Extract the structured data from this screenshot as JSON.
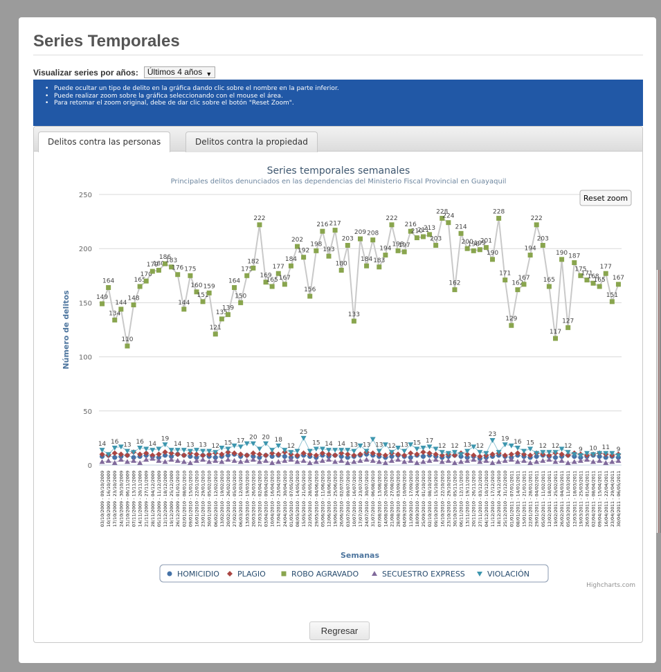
{
  "page": {
    "title": "Series Temporales"
  },
  "filter": {
    "label": "Visualizar series por años:",
    "value": "Últimos 4 años"
  },
  "info": [
    "Puede ocultar un tipo de delito en la gráfica dando clic sobre el nombre en la parte inferior.",
    "Puede realizar zoom sobre la gráfica seleccionando con el mouse el área.",
    "Para retomar el zoom original, debe de dar clic sobre el botón \"Reset Zoom\"."
  ],
  "tabs": [
    {
      "label": "Delitos contra las personas",
      "active": true
    },
    {
      "label": "Delitos contra la propiedad",
      "active": false
    }
  ],
  "chart_controls": {
    "reset_zoom": "Reset zoom",
    "credits": "Highcharts.com"
  },
  "buttons": {
    "back": "Regresar"
  },
  "chart_data": {
    "type": "line",
    "title": "Series temporales semanales",
    "subtitle": "Principales delitos denunciados en las dependencias del Ministerio Fiscal Provincial en Guayaquil",
    "xlabel": "Semanas",
    "ylabel": "Número de delitos",
    "ylim": [
      0,
      250
    ],
    "yticks": [
      0,
      50,
      100,
      150,
      200,
      250
    ],
    "grid": true,
    "legend_position": "bottom",
    "x": [
      "03/10/2009 - 09/10/2009",
      "10/10/2009 - 16/10/2009",
      "17/10/2009 - 23/10/2009",
      "24/10/2009 - 30/10/2009",
      "31/10/2009 - 06/11/2009",
      "07/11/2009 - 13/11/2009",
      "14/11/2009 - 20/11/2009",
      "21/11/2009 - 27/11/2009",
      "28/11/2009 - 04/12/2009",
      "05/12/2009 - 11/12/2009",
      "12/12/2009 - 18/12/2009",
      "19/12/2009 - 25/12/2009",
      "26/12/2009 - 01/01/2010",
      "02/01/2010 - 08/01/2010",
      "09/01/2010 - 15/01/2010",
      "16/01/2010 - 22/01/2010",
      "23/01/2010 - 29/01/2010",
      "30/01/2010 - 05/02/2010",
      "06/02/2010 - 12/02/2010",
      "13/02/2010 - 19/02/2010",
      "20/02/2010 - 26/02/2010",
      "27/02/2010 - 05/03/2010",
      "06/03/2010 - 12/03/2010",
      "13/03/2010 - 19/03/2010",
      "20/03/2010 - 26/03/2010",
      "27/03/2010 - 02/04/2010",
      "03/04/2010 - 09/04/2010",
      "10/04/2010 - 16/04/2010",
      "17/04/2010 - 23/04/2010",
      "24/04/2010 - 30/04/2010",
      "01/05/2010 - 07/05/2010",
      "08/05/2010 - 14/05/2010",
      "15/05/2010 - 21/05/2010",
      "22/05/2010 - 28/05/2010",
      "29/05/2010 - 04/06/2010",
      "05/06/2010 - 11/06/2010",
      "12/06/2010 - 18/06/2010",
      "19/06/2010 - 25/06/2010",
      "26/06/2010 - 02/07/2010",
      "03/07/2010 - 09/07/2010",
      "10/07/2010 - 16/07/2010",
      "17/07/2010 - 23/07/2010",
      "24/07/2010 - 30/07/2010",
      "31/07/2010 - 06/08/2010",
      "07/08/2010 - 13/08/2010",
      "14/08/2010 - 20/08/2010",
      "21/08/2010 - 27/08/2010",
      "28/08/2010 - 03/09/2010",
      "04/09/2010 - 10/09/2010",
      "11/09/2010 - 17/09/2010",
      "18/09/2010 - 24/09/2010",
      "25/09/2010 - 01/10/2010",
      "02/10/2010 - 08/10/2010",
      "09/10/2010 - 15/10/2010",
      "16/10/2010 - 22/10/2010",
      "23/10/2010 - 29/10/2010",
      "30/10/2010 - 05/11/2010",
      "06/11/2010 - 12/11/2010",
      "13/11/2010 - 19/11/2010",
      "20/11/2010 - 26/11/2010",
      "27/11/2010 - 03/12/2010",
      "04/12/2010 - 10/12/2010",
      "11/12/2010 - 17/12/2010",
      "18/12/2010 - 24/12/2010",
      "25/12/2010 - 31/12/2010",
      "01/01/2011 - 07/01/2011",
      "08/01/2011 - 14/01/2011",
      "15/01/2011 - 21/01/2011",
      "22/01/2011 - 28/01/2011",
      "29/01/2011 - 04/02/2011",
      "05/02/2011 - 11/02/2011",
      "12/02/2011 - 18/02/2011",
      "19/02/2011 - 25/02/2011",
      "26/02/2011 - 04/03/2011",
      "05/03/2011 - 11/03/2011",
      "12/03/2011 - 18/03/2011",
      "19/03/2011 - 25/03/2011",
      "26/03/2011 - 01/04/2011",
      "02/04/2011 - 08/04/2011",
      "09/04/2011 - 15/04/2011",
      "16/04/2011 - 22/04/2011",
      "23/04/2011 - 29/04/2011",
      "30/04/2011 - 06/05/2011"
    ],
    "series": [
      {
        "name": "HOMICIDIO",
        "color": "#4572A7",
        "marker": "circle",
        "values": [
          8,
          9,
          7,
          8,
          9,
          7,
          8,
          9,
          8,
          7,
          9,
          8,
          10,
          9,
          8,
          7,
          9,
          8,
          7,
          8,
          9,
          10,
          8,
          9,
          8,
          7,
          9,
          8,
          9,
          8,
          7,
          8,
          9,
          8,
          7,
          9,
          8,
          9,
          8,
          7,
          8,
          9,
          10,
          9,
          8,
          7,
          8,
          9,
          8,
          7,
          9,
          8,
          9,
          8,
          7,
          8,
          9,
          8,
          7,
          8,
          6,
          7,
          8,
          9,
          8,
          7,
          9,
          8,
          7,
          8,
          9,
          8,
          7,
          8,
          9,
          8,
          7,
          8,
          9,
          8,
          7,
          8,
          7
        ]
      },
      {
        "name": "PLAGIO",
        "color": "#AA4643",
        "marker": "diamond",
        "values": [
          10,
          9,
          11,
          10,
          9,
          12,
          10,
          11,
          9,
          10,
          12,
          11,
          10,
          9,
          11,
          10,
          9,
          10,
          11,
          10,
          12,
          11,
          10,
          9,
          11,
          10,
          9,
          11,
          10,
          12,
          10,
          9,
          11,
          10,
          9,
          11,
          10,
          9,
          11,
          10,
          9,
          10,
          12,
          11,
          10,
          9,
          11,
          10,
          9,
          11,
          10,
          12,
          11,
          10,
          9,
          10,
          9,
          11,
          10,
          9,
          8,
          9,
          10,
          11,
          9,
          10,
          11,
          10,
          9,
          11,
          10,
          9,
          11,
          10,
          9,
          11,
          10,
          9,
          10,
          11,
          10,
          9,
          10
        ]
      },
      {
        "name": "ROBO AGRAVADO",
        "color": "#89A54E",
        "marker": "square",
        "values": [
          149,
          164,
          134,
          144,
          110,
          148,
          165,
          170,
          179,
          180,
          186,
          183,
          176,
          144,
          175,
          160,
          151,
          159,
          121,
          135,
          139,
          164,
          150,
          175,
          182,
          222,
          169,
          165,
          177,
          167,
          184,
          202,
          192,
          156,
          198,
          216,
          193,
          217,
          180,
          203,
          133,
          209,
          184,
          208,
          183,
          194,
          222,
          198,
          197,
          216,
          210,
          211,
          213,
          203,
          228,
          224,
          162,
          214,
          200,
          198,
          199,
          201,
          190,
          228,
          171,
          129,
          162,
          167,
          194,
          222,
          203,
          165,
          117,
          190,
          127,
          187,
          175,
          171,
          168,
          165,
          177,
          151,
          167
        ]
      },
      {
        "name": "SECUESTRO EXPRESS",
        "color": "#80699B",
        "marker": "triangle",
        "values": [
          3,
          4,
          2,
          5,
          3,
          4,
          2,
          5,
          6,
          4,
          3,
          5,
          4,
          3,
          2,
          4,
          5,
          3,
          4,
          3,
          5,
          4,
          3,
          4,
          5,
          3,
          4,
          2,
          3,
          4,
          5,
          3,
          4,
          2,
          3,
          4,
          5,
          3,
          4,
          2,
          3,
          4,
          5,
          4,
          3,
          2,
          4,
          5,
          3,
          4,
          2,
          3,
          4,
          5,
          3,
          4,
          2,
          3,
          4,
          5,
          3,
          4,
          2,
          3,
          4,
          5,
          3,
          4,
          2,
          3,
          4,
          5,
          3,
          4,
          2,
          3,
          4,
          5,
          3,
          4,
          2,
          3,
          4
        ]
      },
      {
        "name": "VIOLACIÓN",
        "color": "#3D96AE",
        "marker": "triangle-down",
        "values": [
          14,
          10,
          16,
          17,
          13,
          12,
          16,
          15,
          14,
          15,
          19,
          14,
          14,
          14,
          13,
          14,
          13,
          13,
          12,
          16,
          15,
          18,
          17,
          20,
          20,
          15,
          20,
          14,
          18,
          14,
          12,
          13,
          25,
          13,
          15,
          15,
          14,
          14,
          14,
          14,
          13,
          18,
          13,
          24,
          13,
          19,
          12,
          16,
          13,
          19,
          15,
          16,
          17,
          15,
          12,
          11,
          12,
          10,
          13,
          17,
          12,
          11,
          23,
          12,
          19,
          18,
          16,
          13,
          15,
          11,
          12,
          12,
          12,
          15,
          12,
          10,
          9,
          11,
          10,
          11,
          11,
          11,
          9
        ]
      }
    ]
  }
}
